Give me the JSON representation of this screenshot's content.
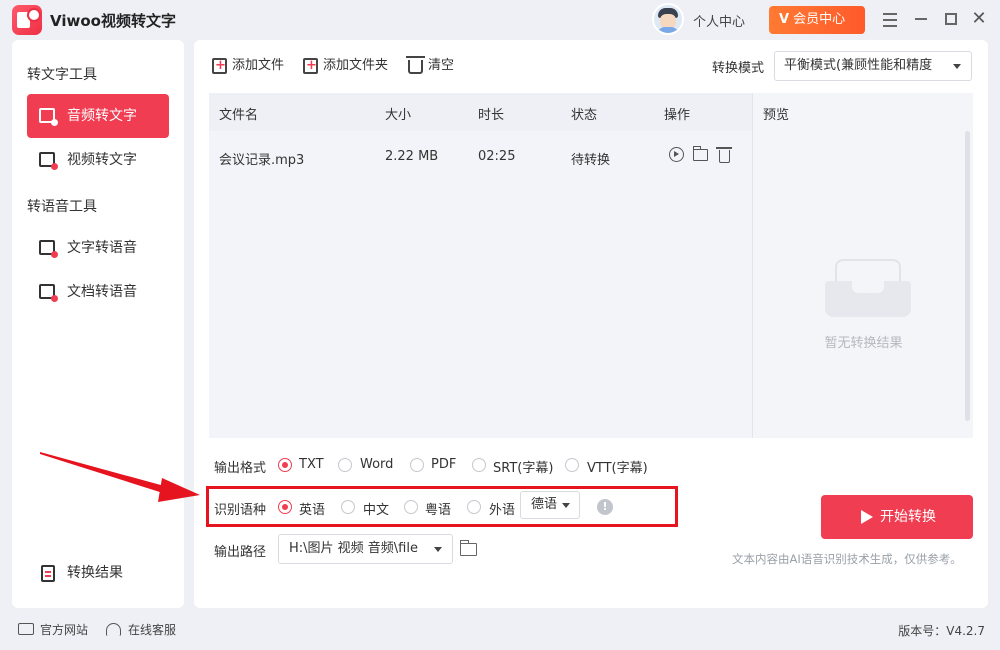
{
  "app": {
    "title": "Viwoo视频转文字"
  },
  "header": {
    "user_center": "个人中心",
    "vip_label": "会员中心",
    "vip_mark": "V",
    "close_glyph": "✕"
  },
  "sidebar": {
    "group1": "转文字工具",
    "items": [
      {
        "label": "音频转文字",
        "active": true
      },
      {
        "label": "视频转文字",
        "active": false
      }
    ],
    "group2": "转语音工具",
    "items2": [
      {
        "label": "文字转语音"
      },
      {
        "label": "文档转语音"
      }
    ],
    "result_label": "转换结果"
  },
  "toolbar": {
    "add_file": "添加文件",
    "add_folder": "添加文件夹",
    "clear": "清空"
  },
  "mode": {
    "label": "转换模式",
    "value": "平衡模式(兼顾性能和精度"
  },
  "table": {
    "headers": [
      "文件名",
      "大小",
      "时长",
      "状态",
      "操作"
    ],
    "rows": [
      {
        "name": "会议记录.mp3",
        "size": "2.22 MB",
        "duration": "02:25",
        "status": "待转换"
      }
    ]
  },
  "preview": {
    "title": "预览",
    "empty_text": "暂无转换结果"
  },
  "output_format": {
    "label": "输出格式",
    "options": [
      "TXT",
      "Word",
      "PDF",
      "SRT(字幕)",
      "VTT(字幕)"
    ],
    "selected": "TXT"
  },
  "language": {
    "label": "识别语种",
    "options": [
      "英语",
      "中文",
      "粤语",
      "外语"
    ],
    "selected": "英语",
    "foreign_value": "德语",
    "info_glyph": "!"
  },
  "output_path": {
    "label": "输出路径",
    "value": "H:\\图片 视频 音频\\file"
  },
  "start_button": "开始转换",
  "disclaimer": "文本内容由AI语音识别技术生成，仅供参考。",
  "footer": {
    "website": "官方网站",
    "support": "在线客服",
    "version": "版本号：V4.2.7"
  },
  "colors": {
    "accent": "#f03d52",
    "vip": "#ff6a2e",
    "highlight_border": "#e6141e"
  },
  "icons": [
    "app-logo",
    "avatar",
    "menu-icon",
    "minimize-icon",
    "maximize-icon",
    "close-icon",
    "play-icon",
    "folder-icon",
    "trash-icon",
    "info-icon",
    "monitor-icon",
    "headset-icon"
  ]
}
